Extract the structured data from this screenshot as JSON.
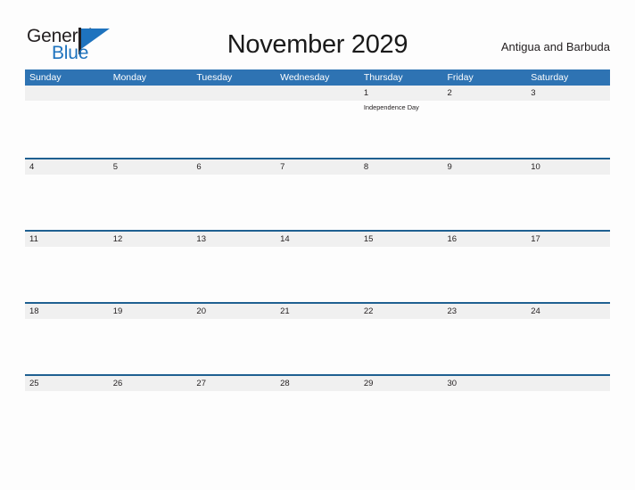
{
  "brand": {
    "name_part1": "General",
    "name_part2": "Blue",
    "mark": "flag-triangle"
  },
  "header": {
    "title": "November 2029",
    "region": "Antigua and Barbuda"
  },
  "colors": {
    "header_blue": "#2e73b3",
    "divider_blue": "#1f6091",
    "band_gray": "#f0f0f0",
    "brand_blue": "#1e73be",
    "text_dark": "#231f20",
    "page_background": "#fdfdfd"
  },
  "calendar": {
    "weekdays": [
      "Sunday",
      "Monday",
      "Tuesday",
      "Wednesday",
      "Thursday",
      "Friday",
      "Saturday"
    ],
    "weeks": [
      {
        "divided": false,
        "days": [
          {
            "number": "",
            "event": ""
          },
          {
            "number": "",
            "event": ""
          },
          {
            "number": "",
            "event": ""
          },
          {
            "number": "",
            "event": ""
          },
          {
            "number": "1",
            "event": "Independence Day"
          },
          {
            "number": "2",
            "event": ""
          },
          {
            "number": "3",
            "event": ""
          }
        ]
      },
      {
        "divided": true,
        "days": [
          {
            "number": "4",
            "event": ""
          },
          {
            "number": "5",
            "event": ""
          },
          {
            "number": "6",
            "event": ""
          },
          {
            "number": "7",
            "event": ""
          },
          {
            "number": "8",
            "event": ""
          },
          {
            "number": "9",
            "event": ""
          },
          {
            "number": "10",
            "event": ""
          }
        ]
      },
      {
        "divided": true,
        "days": [
          {
            "number": "11",
            "event": ""
          },
          {
            "number": "12",
            "event": ""
          },
          {
            "number": "13",
            "event": ""
          },
          {
            "number": "14",
            "event": ""
          },
          {
            "number": "15",
            "event": ""
          },
          {
            "number": "16",
            "event": ""
          },
          {
            "number": "17",
            "event": ""
          }
        ]
      },
      {
        "divided": true,
        "days": [
          {
            "number": "18",
            "event": ""
          },
          {
            "number": "19",
            "event": ""
          },
          {
            "number": "20",
            "event": ""
          },
          {
            "number": "21",
            "event": ""
          },
          {
            "number": "22",
            "event": ""
          },
          {
            "number": "23",
            "event": ""
          },
          {
            "number": "24",
            "event": ""
          }
        ]
      },
      {
        "divided": true,
        "days": [
          {
            "number": "25",
            "event": ""
          },
          {
            "number": "26",
            "event": ""
          },
          {
            "number": "27",
            "event": ""
          },
          {
            "number": "28",
            "event": ""
          },
          {
            "number": "29",
            "event": ""
          },
          {
            "number": "30",
            "event": ""
          },
          {
            "number": "",
            "event": ""
          }
        ]
      }
    ]
  }
}
